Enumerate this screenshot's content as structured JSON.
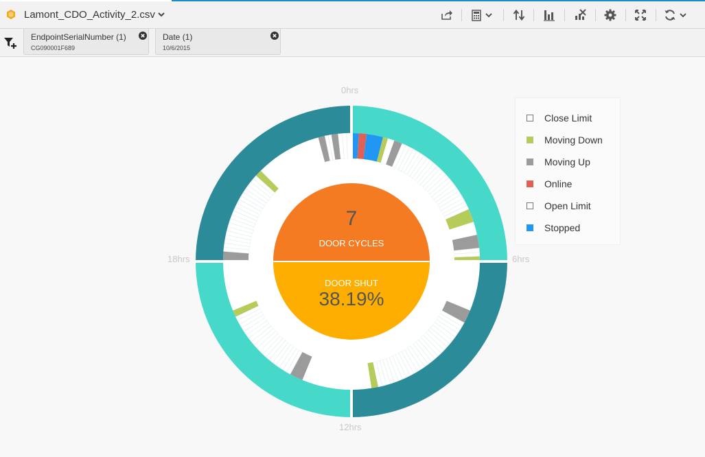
{
  "toolbar": {
    "file_name": "Lamont_CDO_Activity_2.csv",
    "icons": [
      "cube-icon",
      "chevron-down-icon",
      "share-icon",
      "calculator-icon",
      "sort-icon",
      "bar-chart-icon",
      "clear-chart-icon",
      "gear-icon",
      "expand-icon",
      "refresh-icon"
    ]
  },
  "filters": [
    {
      "name": "EndpointSerialNumber",
      "count": "(1)",
      "value": "CG090001F689"
    },
    {
      "name": "Date",
      "count": "(1)",
      "value": "10/6/2015"
    }
  ],
  "chart_data": {
    "type": "radial-activity",
    "hour_labels": [
      "0hrs",
      "6hrs",
      "12hrs",
      "18hrs"
    ],
    "center": {
      "door_cycles_value": "7",
      "door_cycles_label": "DOOR CYCLES",
      "door_shut_label": "DOOR SHUT",
      "door_shut_value": "38.19%"
    },
    "legend": [
      {
        "name": "Close Limit",
        "color": "#ffffff"
      },
      {
        "name": "Moving Down",
        "color": "#b5cc5a"
      },
      {
        "name": "Moving Up",
        "color": "#9b9b9b"
      },
      {
        "name": "Online",
        "color": "#e06055"
      },
      {
        "name": "Open Limit",
        "color": "#ffffff"
      },
      {
        "name": "Stopped",
        "color": "#2196f3"
      }
    ],
    "colors": {
      "dark_teal": "#2b8b98",
      "light_teal": "#46d9c9",
      "orange": "#f57b22",
      "amber": "#fdae00"
    },
    "outer_ring_hours": [
      {
        "from": 0,
        "to": 6,
        "color": "light_teal"
      },
      {
        "from": 6,
        "to": 12,
        "color": "dark_teal"
      },
      {
        "from": 12,
        "to": 18,
        "color": "light_teal"
      },
      {
        "from": 18,
        "to": 24,
        "color": "dark_teal"
      }
    ],
    "activity_segments_hours": [
      {
        "from": 0.0,
        "to": 0.22,
        "state": "Stopped"
      },
      {
        "from": 0.22,
        "to": 0.45,
        "state": "Online"
      },
      {
        "from": 0.45,
        "to": 0.95,
        "state": "Stopped"
      },
      {
        "from": 0.95,
        "to": 1.1,
        "state": "Moving Down"
      },
      {
        "from": 1.3,
        "to": 1.55,
        "state": "Moving Up"
      },
      {
        "from": 1.55,
        "to": 4.4,
        "state": "Open Limit"
      },
      {
        "from": 4.4,
        "to": 4.8,
        "state": "Moving Down"
      },
      {
        "from": 5.2,
        "to": 5.6,
        "state": "Moving Up"
      },
      {
        "from": 5.6,
        "to": 5.85,
        "state": "Close Limit"
      },
      {
        "from": 5.85,
        "to": 6.0,
        "state": "Moving Down"
      },
      {
        "from": 7.5,
        "to": 7.9,
        "state": "Moving Up"
      },
      {
        "from": 7.9,
        "to": 11.2,
        "state": "Open Limit"
      },
      {
        "from": 11.2,
        "to": 11.4,
        "state": "Moving Down"
      },
      {
        "from": 13.5,
        "to": 13.9,
        "state": "Moving Up"
      },
      {
        "from": 13.9,
        "to": 16.3,
        "state": "Open Limit"
      },
      {
        "from": 16.3,
        "to": 16.5,
        "state": "Moving Down"
      },
      {
        "from": 18.0,
        "to": 18.3,
        "state": "Moving Up"
      },
      {
        "from": 18.3,
        "to": 20.8,
        "state": "Open Limit"
      },
      {
        "from": 20.8,
        "to": 21.0,
        "state": "Moving Down"
      },
      {
        "from": 23.0,
        "to": 23.2,
        "state": "Moving Up"
      },
      {
        "from": 23.2,
        "to": 23.4,
        "state": "Close Limit"
      },
      {
        "from": 23.4,
        "to": 23.6,
        "state": "Moving Up"
      },
      {
        "from": 23.6,
        "to": 23.98,
        "state": "Close Limit"
      }
    ]
  }
}
